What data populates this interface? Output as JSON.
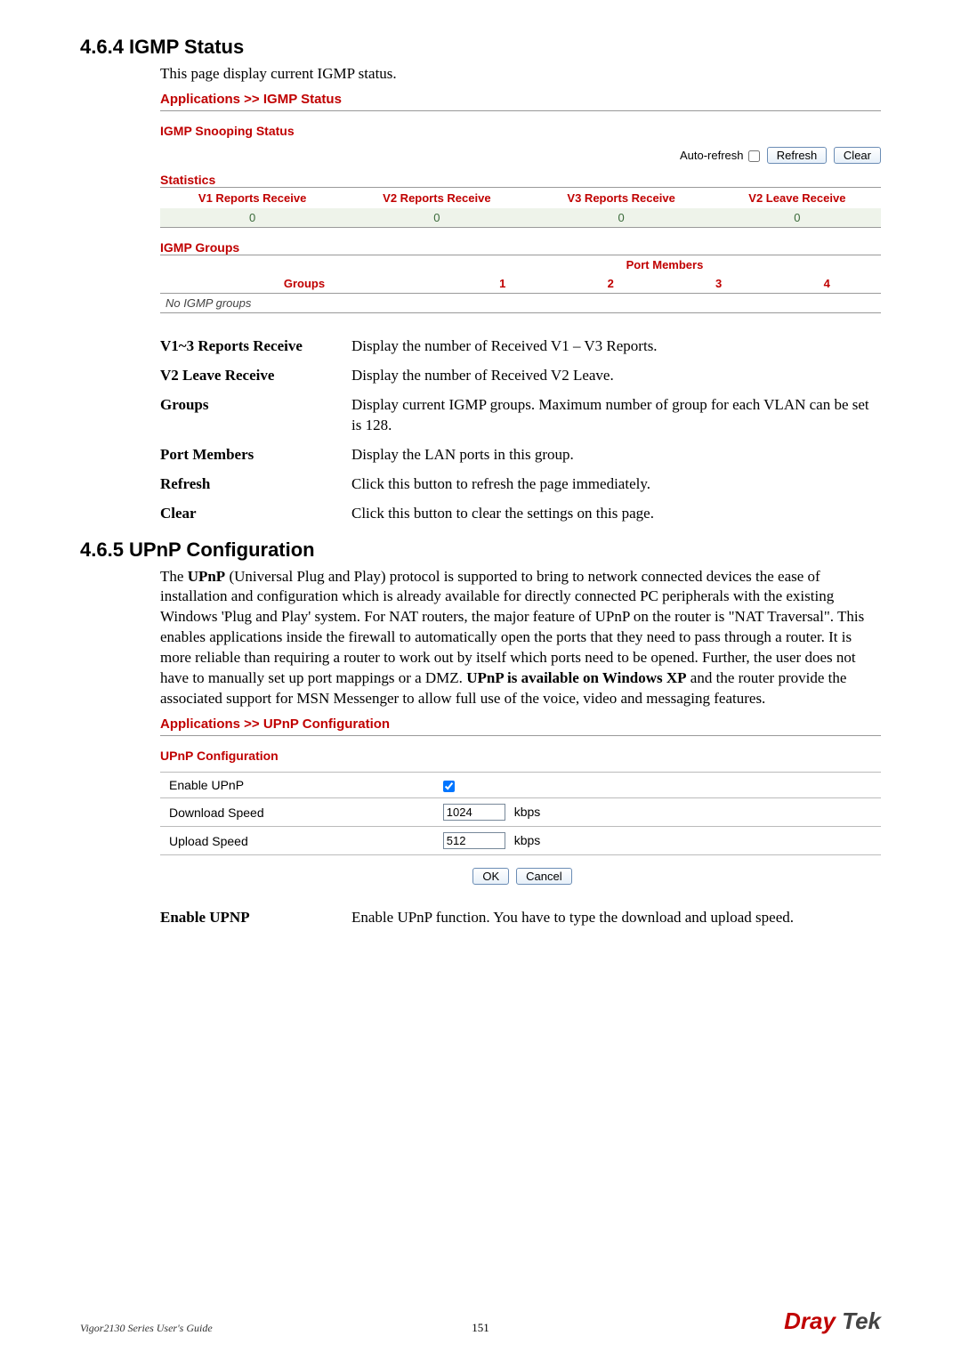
{
  "section1": {
    "heading": "4.6.4 IGMP Status",
    "intro": "This page display current IGMP status."
  },
  "igmpStatus": {
    "appTitle": "Applications >> IGMP Status",
    "panelTitle": "IGMP Snooping Status",
    "autoRefreshLabel": "Auto-refresh",
    "refreshBtn": "Refresh",
    "clearBtn": "Clear",
    "statsTitle": "Statistics",
    "statsHeaders": {
      "v1": "V1 Reports Receive",
      "v2": "V2 Reports Receive",
      "v3": "V3 Reports Receive",
      "v2leave": "V2 Leave Receive"
    },
    "statsValues": {
      "v1": "0",
      "v2": "0",
      "v3": "0",
      "v2leave": "0"
    },
    "groupsTitle": "IGMP Groups",
    "groupsHeader": "Groups",
    "portMembersHeader": "Port Members",
    "portCols": {
      "c1": "1",
      "c2": "2",
      "c3": "3",
      "c4": "4"
    },
    "noGroups": "No IGMP groups"
  },
  "defs1": [
    {
      "term": "V1~3 Reports Receive",
      "desc": "Display the number of Received V1 – V3 Reports."
    },
    {
      "term": "V2 Leave Receive",
      "desc": "Display the number of Received V2 Leave."
    },
    {
      "term": "Groups",
      "desc": "Display current IGMP groups. Maximum number of group for each VLAN can be set is 128."
    },
    {
      "term": "Port Members",
      "desc": "Display the LAN ports in this group."
    },
    {
      "term": "Refresh",
      "desc": "Click this button to refresh the page immediately."
    },
    {
      "term": "Clear",
      "desc": "Click this button to clear the settings on this page."
    }
  ],
  "section2": {
    "heading": "4.6.5 UPnP Configuration",
    "para": "The UPnP (Universal Plug and Play) protocol is supported to bring to network connected devices the ease of installation and configuration which is already available for directly connected PC peripherals with the existing Windows 'Plug and Play' system. For NAT routers, the major feature of UPnP on the router is \"NAT Traversal\". This enables applications inside the firewall to automatically open the ports that they need to pass through a router. It is more reliable than requiring a router to work out by itself which ports need to be opened. Further, the user does not have to manually set up port mappings or a DMZ. UPnP is available on Windows XP and the router provide the associated support for MSN Messenger to allow full use of the voice, video and messaging features."
  },
  "upnp": {
    "appTitle": "Applications >> UPnP Configuration",
    "panelTitle": "UPnP Configuration",
    "rows": {
      "enableLabel": "Enable UPnP",
      "downloadLabel": "Download Speed",
      "downloadValue": "1024",
      "uploadLabel": "Upload Speed",
      "uploadValue": "512",
      "unit": "kbps"
    },
    "okBtn": "OK",
    "cancelBtn": "Cancel"
  },
  "defs2": [
    {
      "term": "Enable UPNP",
      "desc": "Enable UPnP function. You have to type the download and upload speed."
    }
  ],
  "footer": {
    "left": "Vigor2130 Series User's Guide",
    "page": "151",
    "logoDray": "Dray",
    "logoTek": " Tek"
  }
}
